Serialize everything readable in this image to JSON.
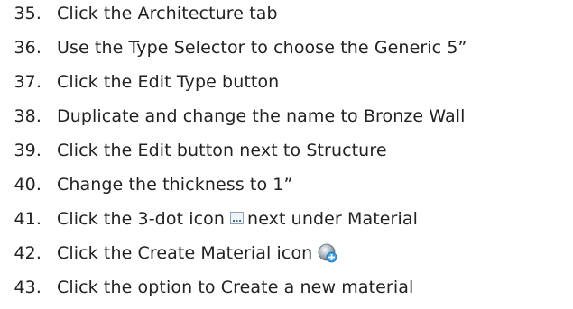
{
  "steps": [
    {
      "num": "35.",
      "text": "Click the Architecture tab"
    },
    {
      "num": "36.",
      "text": "Use the Type Selector to choose the Generic 5”"
    },
    {
      "num": "37.",
      "text": "Click the Edit Type button"
    },
    {
      "num": "38.",
      "text": "Duplicate and change the name to Bronze Wall"
    },
    {
      "num": "39.",
      "text": "Click the Edit button next to Structure"
    },
    {
      "num": "40.",
      "text": "Change the thickness to 1”"
    },
    {
      "num": "41.",
      "text_before": "Click the 3-dot icon",
      "icon": "three-dot-icon",
      "text_after": "next under Material"
    },
    {
      "num": "42.",
      "text": "Click the Create Material icon",
      "icon": "create-material-icon"
    },
    {
      "num": "43.",
      "text": "Click the option to Create a new material"
    }
  ],
  "colors": {
    "text": "#222222",
    "icon_blue": "#4a86c8",
    "icon_plus": "#3aa0e8"
  }
}
